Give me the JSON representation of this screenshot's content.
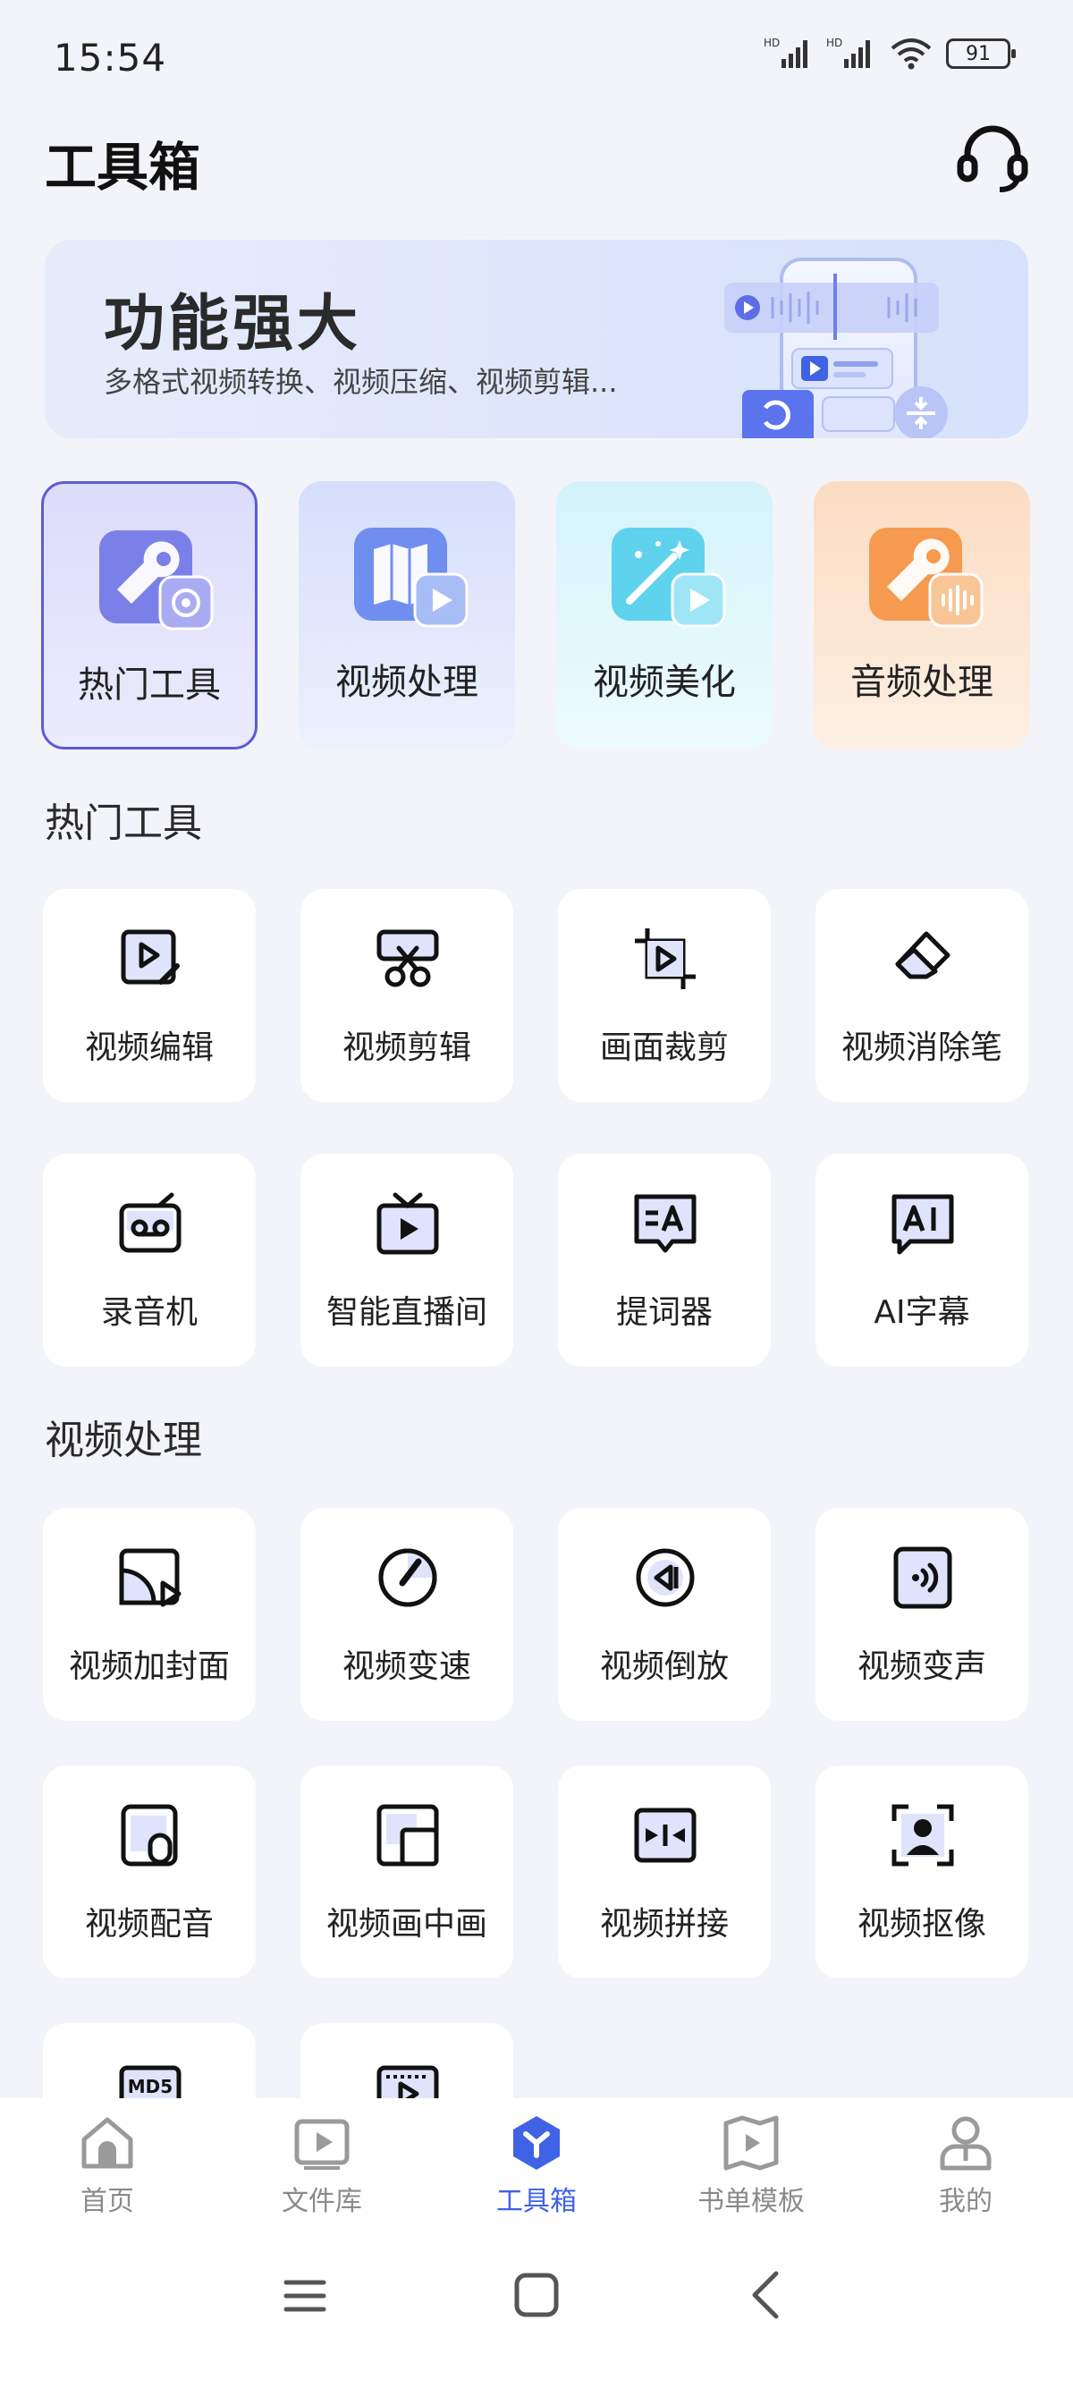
{
  "status": {
    "time": "15:54",
    "battery": "91"
  },
  "header": {
    "title": "工具箱"
  },
  "banner": {
    "title": "功能强大",
    "subtitle": "多格式视频转换、视频压缩、视频剪辑..."
  },
  "categories": [
    {
      "label": "热门工具",
      "icon": "wrench-icon"
    },
    {
      "label": "视频处理",
      "icon": "map-video-icon"
    },
    {
      "label": "视频美化",
      "icon": "magic-wand-icon"
    },
    {
      "label": "音频处理",
      "icon": "audio-wrench-icon"
    }
  ],
  "sections": {
    "hot": {
      "title": "热门工具",
      "items": [
        {
          "label": "视频编辑",
          "icon": "video-edit-icon"
        },
        {
          "label": "视频剪辑",
          "icon": "scissors-icon"
        },
        {
          "label": "画面裁剪",
          "icon": "crop-icon"
        },
        {
          "label": "视频消除笔",
          "icon": "eraser-icon"
        },
        {
          "label": "录音机",
          "icon": "recorder-icon"
        },
        {
          "label": "智能直播间",
          "icon": "tv-live-icon"
        },
        {
          "label": "提词器",
          "icon": "prompter-icon"
        },
        {
          "label": "AI字幕",
          "icon": "ai-subtitle-icon"
        }
      ]
    },
    "video": {
      "title": "视频处理",
      "items": [
        {
          "label": "视频加封面",
          "icon": "cover-icon"
        },
        {
          "label": "视频变速",
          "icon": "speed-icon"
        },
        {
          "label": "视频倒放",
          "icon": "reverse-icon"
        },
        {
          "label": "视频变声",
          "icon": "voice-change-icon"
        },
        {
          "label": "视频配音",
          "icon": "dubbing-icon"
        },
        {
          "label": "视频画中画",
          "icon": "pip-icon"
        },
        {
          "label": "视频拼接",
          "icon": "merge-icon"
        },
        {
          "label": "视频抠像",
          "icon": "portrait-cutout-icon"
        }
      ],
      "partial_icons": [
        "md5-icon",
        "video-frame-icon"
      ],
      "md5_text": "MD5"
    }
  },
  "nav": [
    {
      "label": "首页",
      "icon": "home-icon"
    },
    {
      "label": "文件库",
      "icon": "file-library-icon"
    },
    {
      "label": "工具箱",
      "icon": "toolbox-icon"
    },
    {
      "label": "书单模板",
      "icon": "book-template-icon"
    },
    {
      "label": "我的",
      "icon": "profile-icon"
    }
  ],
  "colors": {
    "accent": "#3f63e4",
    "selected_border": "#5c5cd4",
    "background": "#f3f4f9"
  }
}
